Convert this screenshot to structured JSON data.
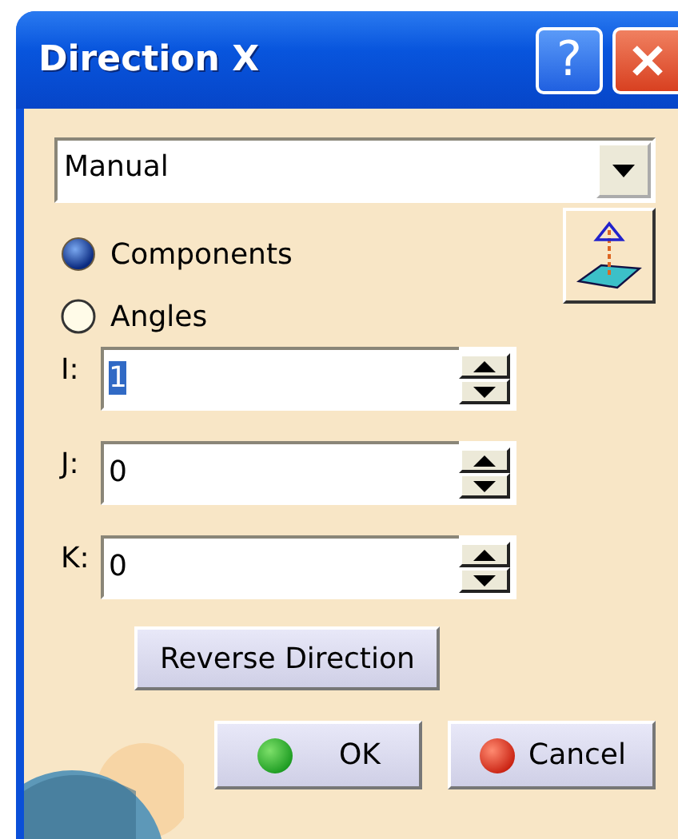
{
  "window": {
    "title": "Direction X"
  },
  "title_buttons": [
    {
      "kind": "help",
      "label": "?"
    },
    {
      "kind": "close"
    }
  ],
  "mode_dropdown": {
    "value": "Manual"
  },
  "options": [
    {
      "label": "Components",
      "selected": true
    },
    {
      "label": "Angles",
      "selected": false
    }
  ],
  "fields": [
    {
      "label": "I:",
      "value": "1",
      "selected": true
    },
    {
      "label": "J:",
      "value": "0",
      "selected": false
    },
    {
      "label": "K:",
      "value": "0",
      "selected": false
    }
  ],
  "reverse_button": {
    "label": "Reverse Direction"
  },
  "footer_buttons": [
    {
      "label": "OK",
      "kind": "ok"
    },
    {
      "label": "Cancel",
      "kind": "cancel"
    }
  ]
}
